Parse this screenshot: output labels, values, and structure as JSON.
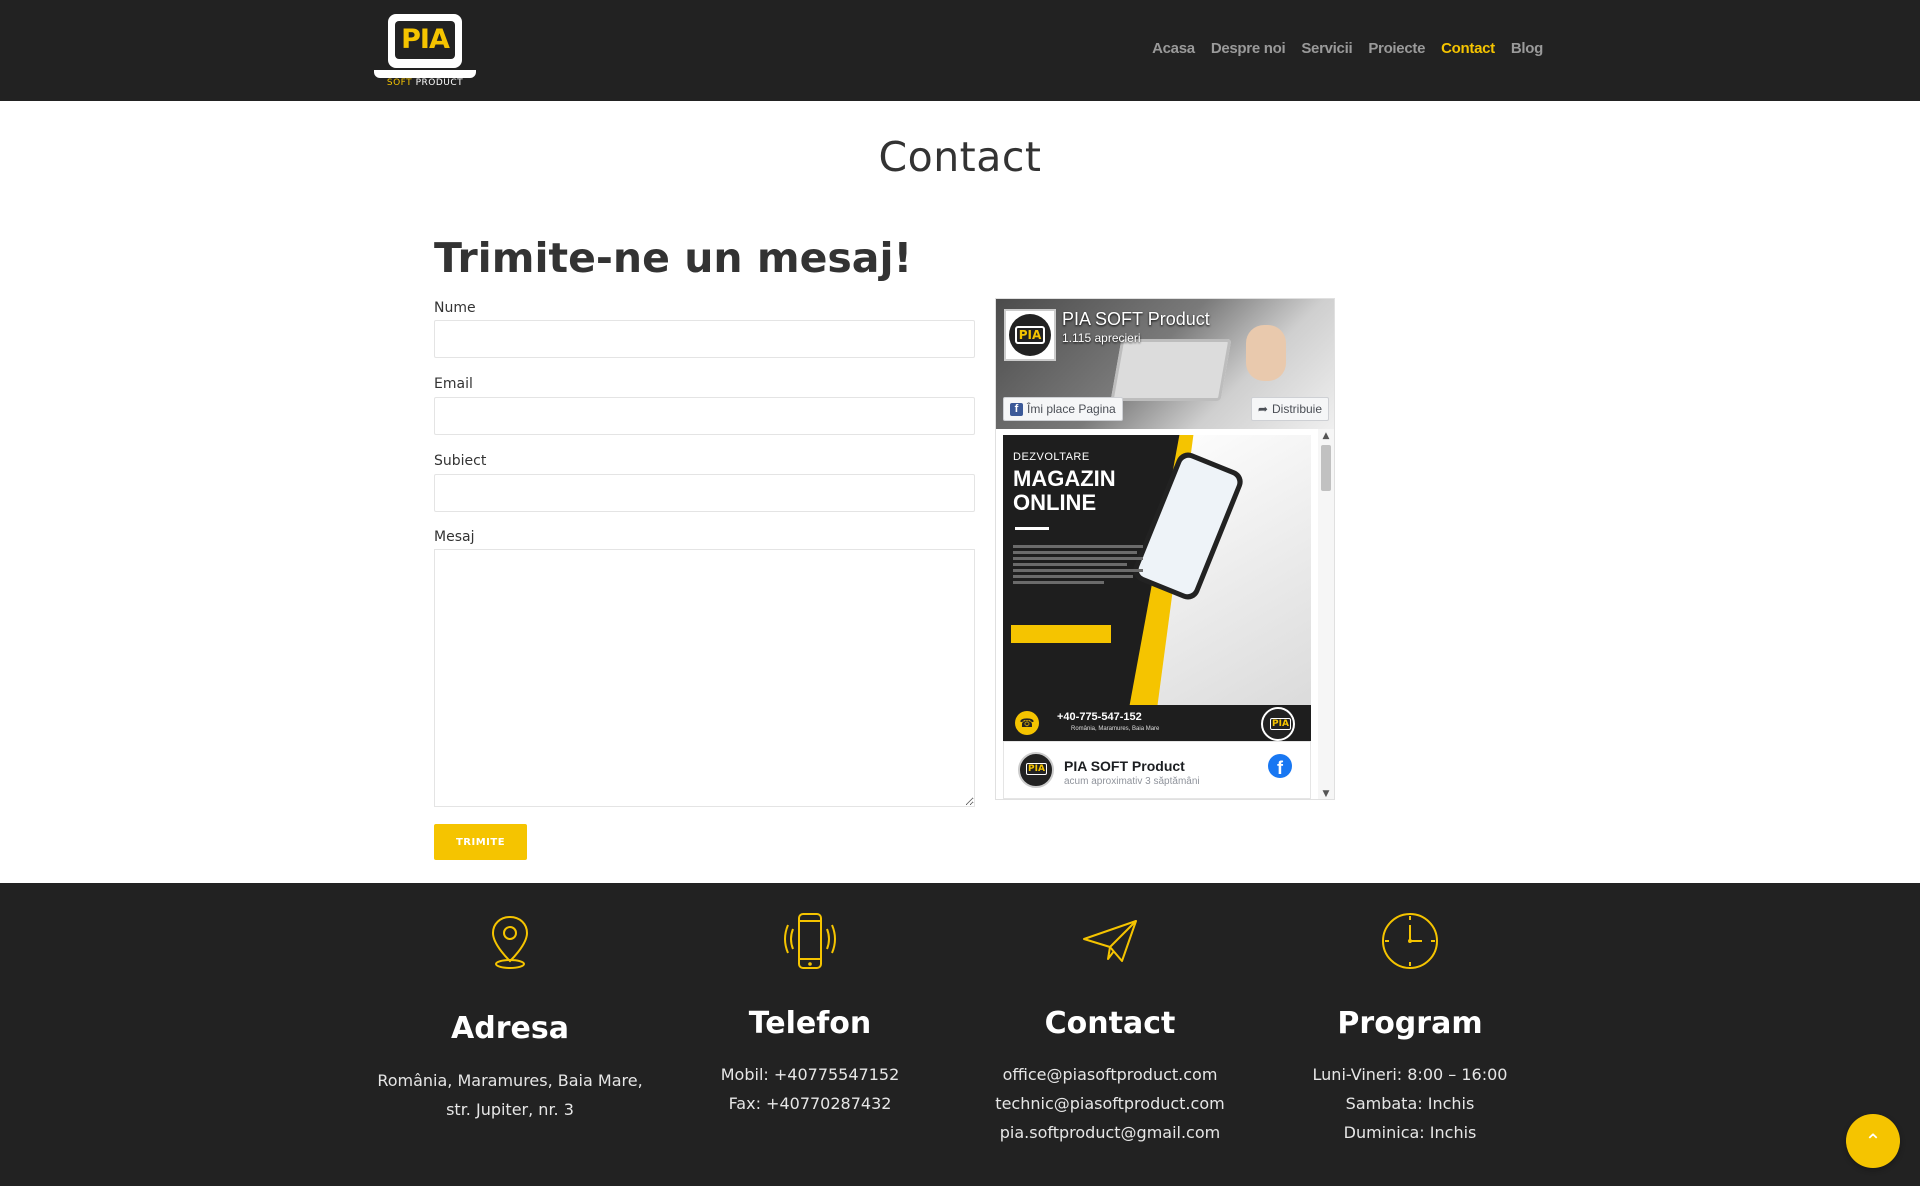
{
  "logo": {
    "brand": "PIA",
    "sub_soft": "SOFT",
    "sub_product": "PRODUCT"
  },
  "nav": [
    {
      "label": "Acasa",
      "active": false
    },
    {
      "label": "Despre noi",
      "active": false
    },
    {
      "label": "Servicii",
      "active": false
    },
    {
      "label": "Proiecte",
      "active": false
    },
    {
      "label": "Contact",
      "active": true
    },
    {
      "label": "Blog",
      "active": false
    }
  ],
  "page": {
    "title": "Contact"
  },
  "form": {
    "title": "Trimite-ne un mesaj!",
    "name_label": "Nume",
    "email_label": "Email",
    "subject_label": "Subiect",
    "message_label": "Mesaj",
    "name_value": "",
    "email_value": "",
    "subject_value": "",
    "message_value": "",
    "submit_label": "TRIMITE"
  },
  "facebook": {
    "page_name": "PIA SOFT Product",
    "likes": "1.115 aprecieri",
    "like_button": "Îmi place Pagina",
    "share_button": "Distribuie",
    "post": {
      "kicker": "DEZVOLTARE",
      "headline": "MAGAZIN ONLINE",
      "phone": "+40-775-547-152",
      "address": "România, Maramures, Baia Mare",
      "author": "PIA SOFT Product",
      "time": "acum aproximativ 3 săptămâni"
    }
  },
  "footer": {
    "address": {
      "title": "Adresa",
      "line1": "România, Maramures, Baia Mare,",
      "line2": "str. Jupiter, nr. 3"
    },
    "phone": {
      "title": "Telefon",
      "line1": "Mobil: +40775547152",
      "line2": "Fax: +40770287432"
    },
    "contact": {
      "title": "Contact",
      "line1": "office@piasoftproduct.com",
      "line2": "technic@piasoftproduct.com",
      "line3": "pia.softproduct@gmail.com"
    },
    "program": {
      "title": "Program",
      "line1": "Luni-Vineri: 8:00 – 16:00",
      "line2": "Sambata: Inchis",
      "line3": "Duminica: Inchis"
    }
  },
  "icons": {
    "location": "map-pin-icon",
    "phone": "smartphone-icon",
    "contact": "paper-plane-icon",
    "program": "clock-icon",
    "back_to_top": "chevron-up-icon"
  },
  "colors": {
    "accent": "#f5c400",
    "dark": "#222222",
    "text": "#333333"
  }
}
